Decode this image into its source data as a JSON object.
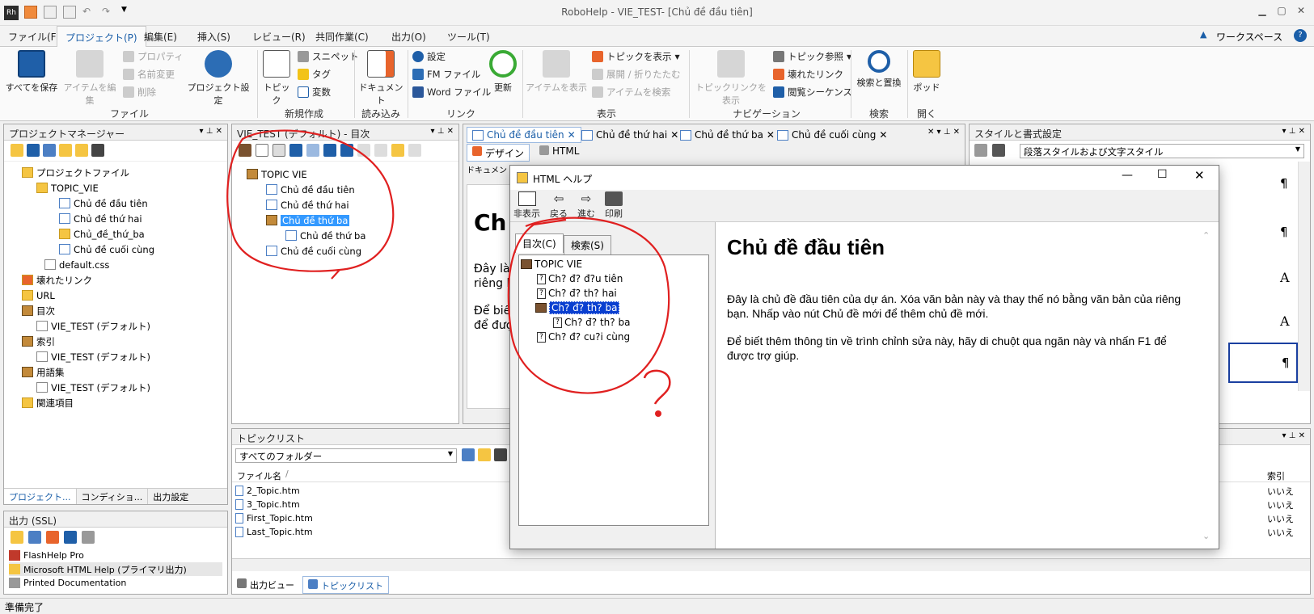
{
  "app": {
    "title": "RoboHelp - VIE_TEST- [Chủ đề đầu tiên]",
    "logo": "Rh"
  },
  "menu": {
    "tabs": [
      "ファイル(F)",
      "プロジェクト(P)",
      "編集(E)",
      "挿入(S)",
      "レビュー(R)",
      "共同作業(C)",
      "出力(O)",
      "ツール(T)"
    ],
    "active_index": 1,
    "workspace": "ワークスペース"
  },
  "ribbon": {
    "groups": {
      "file": {
        "label": "ファイル",
        "save_all": "すべてを保存",
        "edit_item": "アイテムを編集",
        "properties": "プロパティ",
        "rename": "名前変更",
        "delete": "削除",
        "project_settings": "プロジェクト設定"
      },
      "new": {
        "label": "新規作成",
        "topic": "トピック",
        "snippet": "スニペット",
        "tag": "タグ",
        "variable": "変数"
      },
      "import": {
        "label": "読み込み",
        "document": "ドキュメント"
      },
      "link": {
        "label": "リンク",
        "settings": "設定",
        "fm_file": "FM ファイル",
        "word_file": "Word ファイル",
        "update": "更新"
      },
      "view": {
        "label": "表示",
        "show_item": "アイテムを表示",
        "show_topic": "トピックを表示",
        "expand_collapse": "展開 / 折りたたむ",
        "find_item": "アイテムを検索"
      },
      "navigation": {
        "label": "ナビゲーション",
        "show_topic_links": "トピックリンクを表示",
        "topic_ref": "トピック参照",
        "broken_links": "壊れたリンク",
        "browse_seq": "閲覧シーケンス"
      },
      "search": {
        "label": "検索",
        "find_replace": "検索と置換"
      },
      "open": {
        "label": "開く",
        "pod": "ポッド"
      }
    }
  },
  "project_manager": {
    "title": "プロジェクトマネージャー",
    "tree": [
      {
        "label": "プロジェクトファイル",
        "icon": "folder-icon",
        "level": 0
      },
      {
        "label": "TOPIC_VIE",
        "icon": "folder-icon",
        "level": 1
      },
      {
        "label": "Chủ đề đầu tiên",
        "icon": "topic-icon",
        "level": 2
      },
      {
        "label": "Chủ đề thứ hai",
        "icon": "topic-icon",
        "level": 2
      },
      {
        "label": "Chủ_đề_thứ_ba",
        "icon": "folder-icon",
        "level": 2
      },
      {
        "label": "Chủ đề cuối cùng",
        "icon": "topic-icon",
        "level": 2
      },
      {
        "label": "default.css",
        "icon": "css-icon",
        "level": 1
      },
      {
        "label": "壊れたリンク",
        "icon": "broken-link-icon",
        "level": 0
      },
      {
        "label": "URL",
        "icon": "folder-icon",
        "level": 0
      },
      {
        "label": "目次",
        "icon": "toc-icon",
        "level": 0
      },
      {
        "label": "VIE_TEST (デフォルト)",
        "icon": "toc-file-icon",
        "level": 1
      },
      {
        "label": "索引",
        "icon": "index-icon",
        "level": 0
      },
      {
        "label": "VIE_TEST (デフォルト)",
        "icon": "index-file-icon",
        "level": 1
      },
      {
        "label": "用語集",
        "icon": "glossary-icon",
        "level": 0
      },
      {
        "label": "VIE_TEST (デフォルト)",
        "icon": "glossary-file-icon",
        "level": 1
      },
      {
        "label": "関連項目",
        "icon": "related-icon",
        "level": 0
      }
    ],
    "bottom_tabs": [
      "プロジェクト...",
      "コンディショ...",
      "出力設定"
    ]
  },
  "toc_panel": {
    "title": "VIE_TEST (デフォルト) - 目次",
    "tree": [
      {
        "label": "TOPIC VIE",
        "type": "book",
        "level": 0
      },
      {
        "label": "Chủ đề đầu tiên",
        "type": "page",
        "level": 1
      },
      {
        "label": "Chủ đề thứ hai",
        "type": "page",
        "level": 1
      },
      {
        "label": "Chủ đề thứ ba",
        "type": "book",
        "level": 1,
        "selected": true
      },
      {
        "label": "Chủ đề thứ ba",
        "type": "page",
        "level": 2
      },
      {
        "label": "Chủ đề cuối cùng",
        "type": "page",
        "level": 1
      }
    ]
  },
  "editor": {
    "tabs": [
      "Chủ đề đầu tiên",
      "Chủ đề thứ hai",
      "Chủ đề thứ ba",
      "Chủ đề cuối cùng"
    ],
    "view_tabs": [
      "デザイン",
      "HTML"
    ],
    "ruler_label": "ドキュメント",
    "heading_fragment": "Ch",
    "line1": "Đây là",
    "line2": "riêng b",
    "line3": "Để biế",
    "line4": "để đượ"
  },
  "styles_panel": {
    "title": "スタイルと書式設定",
    "dropdown": "段落スタイルおよび文字スタイル",
    "glyphs": [
      "¶",
      "¶",
      "A",
      "A",
      "¶"
    ]
  },
  "output_panel": {
    "title": "出力 (SSL)",
    "items": [
      "FlashHelp Pro",
      "Microsoft HTML Help (プライマリ出力)",
      "Printed Documentation"
    ]
  },
  "topic_list": {
    "title": "トピックリスト",
    "folder_filter": "すべてのフォルダー",
    "col_filename": "ファイル名",
    "col_index": "索引",
    "rows": [
      {
        "file": "2_Topic.htm",
        "index": "いいえ"
      },
      {
        "file": "3_Topic.htm",
        "index": "いいえ"
      },
      {
        "file": "First_Topic.htm",
        "index": "いいえ"
      },
      {
        "file": "Last_Topic.htm",
        "index": "いいえ"
      }
    ],
    "bottom_tabs": [
      "出力ビュー",
      "トピックリスト"
    ]
  },
  "help_window": {
    "title": "HTML ヘルプ",
    "toolbar": [
      "非表示",
      "戻る",
      "進む",
      "印刷"
    ],
    "tabs": [
      "目次(C)",
      "検索(S)"
    ],
    "tree": [
      {
        "label": "TOPIC VIE",
        "type": "book",
        "level": 0
      },
      {
        "label": "Ch? đ? đ?u tiên",
        "type": "page",
        "level": 1
      },
      {
        "label": "Ch? đ? th? hai",
        "type": "page",
        "level": 1
      },
      {
        "label": "Ch? đ? th? ba",
        "type": "book",
        "level": 1,
        "selected": true
      },
      {
        "label": "Ch? đ? th? ba",
        "type": "page",
        "level": 2
      },
      {
        "label": "Ch? đ? cu?i cùng",
        "type": "page",
        "level": 1
      }
    ],
    "content_title": "Chủ đề đầu tiên",
    "para1": "Đây là chủ đề đầu tiên của dự án. Xóa văn bản này và thay thế nó bằng văn bản của riêng bạn. Nhấp vào nút Chủ đề mới để thêm chủ đề mới.",
    "para2": "Để biết thêm thông tin về trình chỉnh sửa này, hãy di chuột qua ngăn này và nhấn F1 để được trợ giúp."
  },
  "status": {
    "text": "準備完了"
  },
  "annotation": {
    "color": "#e02020"
  }
}
